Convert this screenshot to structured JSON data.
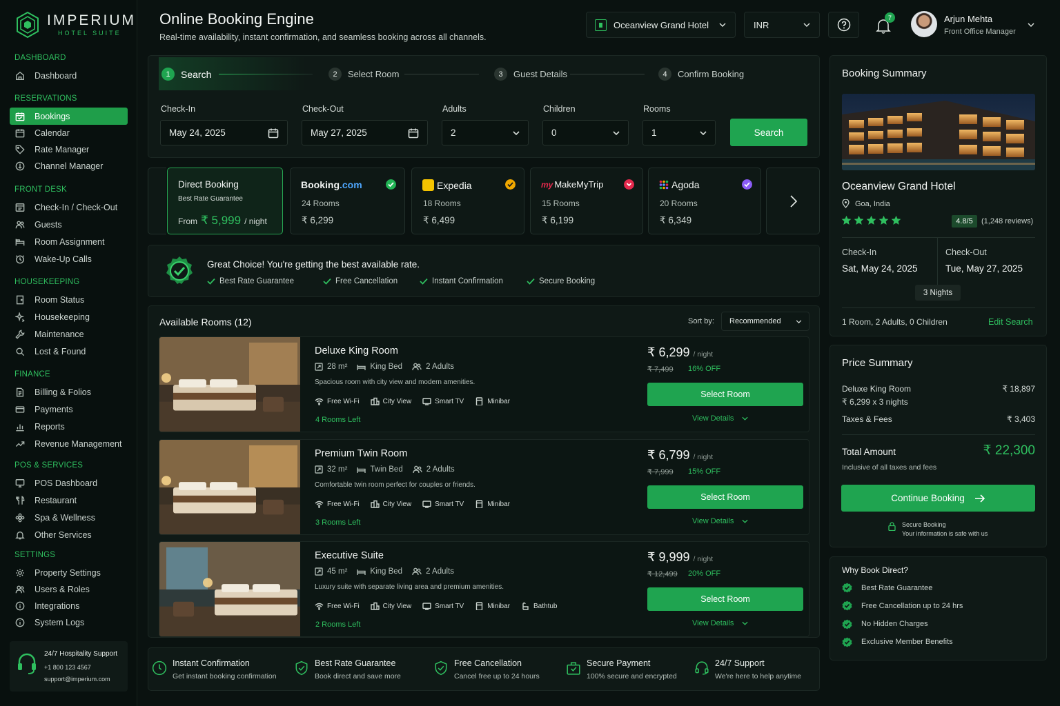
{
  "brand": {
    "name": "IMPERIUM",
    "sub": "HOTEL SUITE"
  },
  "sidebar": {
    "sections": [
      {
        "title": "DASHBOARD",
        "items": [
          {
            "label": "Dashboard",
            "icon": "home-icon"
          }
        ]
      },
      {
        "title": "RESERVATIONS",
        "items": [
          {
            "label": "Bookings",
            "icon": "calendar-check-icon",
            "active": true
          },
          {
            "label": "Calendar",
            "icon": "calendar-icon"
          },
          {
            "label": "Rate Manager",
            "icon": "tag-icon"
          },
          {
            "label": "Channel Manager",
            "icon": "globe-icon"
          }
        ]
      },
      {
        "title": "FRONT DESK",
        "items": [
          {
            "label": "Check-In / Check-Out",
            "icon": "checkin-icon"
          },
          {
            "label": "Guests",
            "icon": "users-icon"
          },
          {
            "label": "Room Assignment",
            "icon": "bed-icon"
          },
          {
            "label": "Wake-Up Calls",
            "icon": "clock-icon"
          }
        ]
      },
      {
        "title": "HOUSEKEEPING",
        "items": [
          {
            "label": "Room Status",
            "icon": "door-icon"
          },
          {
            "label": "Housekeeping",
            "icon": "sparkle-icon"
          },
          {
            "label": "Maintenance",
            "icon": "wrench-icon"
          },
          {
            "label": "Lost & Found",
            "icon": "search-icon"
          }
        ]
      },
      {
        "title": "FINANCE",
        "items": [
          {
            "label": "Billing & Folios",
            "icon": "document-icon"
          },
          {
            "label": "Payments",
            "icon": "card-icon"
          },
          {
            "label": "Reports",
            "icon": "chart-icon"
          },
          {
            "label": "Revenue Management",
            "icon": "trend-icon"
          }
        ]
      },
      {
        "title": "POS & SERVICES",
        "items": [
          {
            "label": "POS Dashboard",
            "icon": "monitor-icon"
          },
          {
            "label": "Restaurant",
            "icon": "fork-icon"
          },
          {
            "label": "Spa & Wellness",
            "icon": "flower-icon"
          },
          {
            "label": "Other Services",
            "icon": "bell-icon"
          }
        ]
      },
      {
        "title": "SETTINGS",
        "items": [
          {
            "label": "Property Settings",
            "icon": "gear-icon"
          },
          {
            "label": "Users & Roles",
            "icon": "users-icon"
          },
          {
            "label": "Integrations",
            "icon": "info-icon"
          },
          {
            "label": "System Logs",
            "icon": "info-icon"
          }
        ]
      }
    ],
    "support": {
      "title": "24/7 Hospitality Support",
      "phone": "+1 800 123 4567",
      "email": "support@imperium.com"
    }
  },
  "header": {
    "title": "Online Booking Engine",
    "subtitle": "Real-time availability, instant confirmation, and seamless booking across all channels.",
    "hotel_select": "Oceanview Grand Hotel",
    "currency": "INR",
    "notifications": "7",
    "user": {
      "name": "Arjun Mehta",
      "role": "Front Office Manager"
    }
  },
  "steps": [
    {
      "num": "1",
      "label": "Search"
    },
    {
      "num": "2",
      "label": "Select Room"
    },
    {
      "num": "3",
      "label": "Guest Details"
    },
    {
      "num": "4",
      "label": "Confirm Booking"
    }
  ],
  "search": {
    "checkin_label": "Check-In",
    "checkin": "May 24, 2025",
    "checkout_label": "Check-Out",
    "checkout": "May 27, 2025",
    "adults_label": "Adults",
    "adults": "2",
    "children_label": "Children",
    "children": "0",
    "rooms_label": "Rooms",
    "rooms": "1",
    "button": "Search"
  },
  "channels": {
    "direct": {
      "name": "Direct Booking",
      "sub": "Best Rate Guarantee",
      "from": "From",
      "price": "₹ 5,999",
      "unit": "/ night"
    },
    "list": [
      {
        "name_a": "Booking",
        "name_b": ".com",
        "rooms": "24 Rooms",
        "price": "₹  6,299",
        "badge_color": "#22b455"
      },
      {
        "name": "Expedia",
        "rooms": "18 Rooms",
        "price": "₹  6,499",
        "badge_color": "#f0a800"
      },
      {
        "name": "MakeMyTrip",
        "rooms": "15 Rooms",
        "price": "₹  6,199",
        "badge_color": "#e5294d"
      },
      {
        "name": "Agoda",
        "rooms": "20 Rooms",
        "price": "₹  6,349",
        "badge_color": "#8b5cf6"
      }
    ]
  },
  "banner": {
    "title": "Great Choice! You're getting the best available rate.",
    "features": [
      "Best Rate Guarantee",
      "Free Cancellation",
      "Instant Confirmation",
      "Secure Booking"
    ]
  },
  "rooms_section": {
    "title": "Available Rooms",
    "count": "(12)",
    "sort_label": "Sort by:",
    "sort_value": "Recommended"
  },
  "rooms": [
    {
      "name": "Deluxe King Room",
      "size": "28 m²",
      "bed": "King Bed",
      "guests": "2 Adults",
      "desc": "Spacious room with city view and modern amenities.",
      "amenities": [
        "Free Wi-Fi",
        "City View",
        "Smart TV",
        "Minibar"
      ],
      "left": "4 Rooms Left",
      "price": "₹ 6,299",
      "unit": "/ night",
      "old": "₹ 7,499",
      "off": "16% OFF",
      "select": "Select Room",
      "details": "View Details"
    },
    {
      "name": "Premium Twin Room",
      "size": "32 m²",
      "bed": "Twin Bed",
      "guests": "2 Adults",
      "desc": "Comfortable twin room perfect for couples or friends.",
      "amenities": [
        "Free Wi-Fi",
        "City View",
        "Smart TV",
        "Minibar"
      ],
      "left": "3 Rooms Left",
      "price": "₹ 6,799",
      "unit": "/ night",
      "old": "₹ 7,999",
      "off": "15% OFF",
      "select": "Select Room",
      "details": "View Details"
    },
    {
      "name": "Executive Suite",
      "size": "45 m²",
      "bed": "King Bed",
      "guests": "2 Adults",
      "desc": "Luxury suite with separate living area and premium amenities.",
      "amenities": [
        "Free Wi-Fi",
        "City View",
        "Smart TV",
        "Minibar",
        "Bathtub"
      ],
      "left": "2 Rooms Left",
      "price": "₹ 9,999",
      "unit": "/ night",
      "old": "₹ 12,499",
      "off": "20% OFF",
      "select": "Select Room",
      "details": "View Details"
    }
  ],
  "benefits": [
    {
      "title": "Instant Confirmation",
      "sub": "Get instant booking confirmation"
    },
    {
      "title": "Best Rate Guarantee",
      "sub": "Book direct and save more"
    },
    {
      "title": "Free Cancellation",
      "sub": "Cancel free up to 24 hours"
    },
    {
      "title": "Secure Payment",
      "sub": "100% secure and encrypted"
    },
    {
      "title": "24/7 Support",
      "sub": "We're here to help anytime"
    }
  ],
  "summary": {
    "title": "Booking Summary",
    "hotel": "Oceanview Grand Hotel",
    "location": "Goa, India",
    "stars": 5,
    "rating": "4.8/5",
    "reviews": "(1,248 reviews)",
    "checkin_label": "Check-In",
    "checkin": "Sat, May 24, 2025",
    "checkout_label": "Check-Out",
    "checkout": "Tue, May 27, 2025",
    "nights": "3 Nights",
    "guests": "1 Room, 2 Adults, 0 Children",
    "edit": "Edit Search"
  },
  "price_summary": {
    "title": "Price Summary",
    "room": "Deluxe King Room",
    "room_amount": "₹ 18,897",
    "room_calc": "₹ 6,299 x 3 nights",
    "taxes": "Taxes & Fees",
    "taxes_amount": "₹ 3,403",
    "total_label": "Total Amount",
    "total": "₹ 22,300",
    "total_note": "Inclusive of all taxes and fees",
    "cta": "Continue Booking",
    "secure_title": "Secure Booking",
    "secure_sub": "Your information is safe with us"
  },
  "why": {
    "title": "Why Book Direct?",
    "items": [
      "Best Rate Guarantee",
      "Free Cancellation up to 24 hrs",
      "No Hidden Charges",
      "Exclusive Member Benefits"
    ]
  }
}
